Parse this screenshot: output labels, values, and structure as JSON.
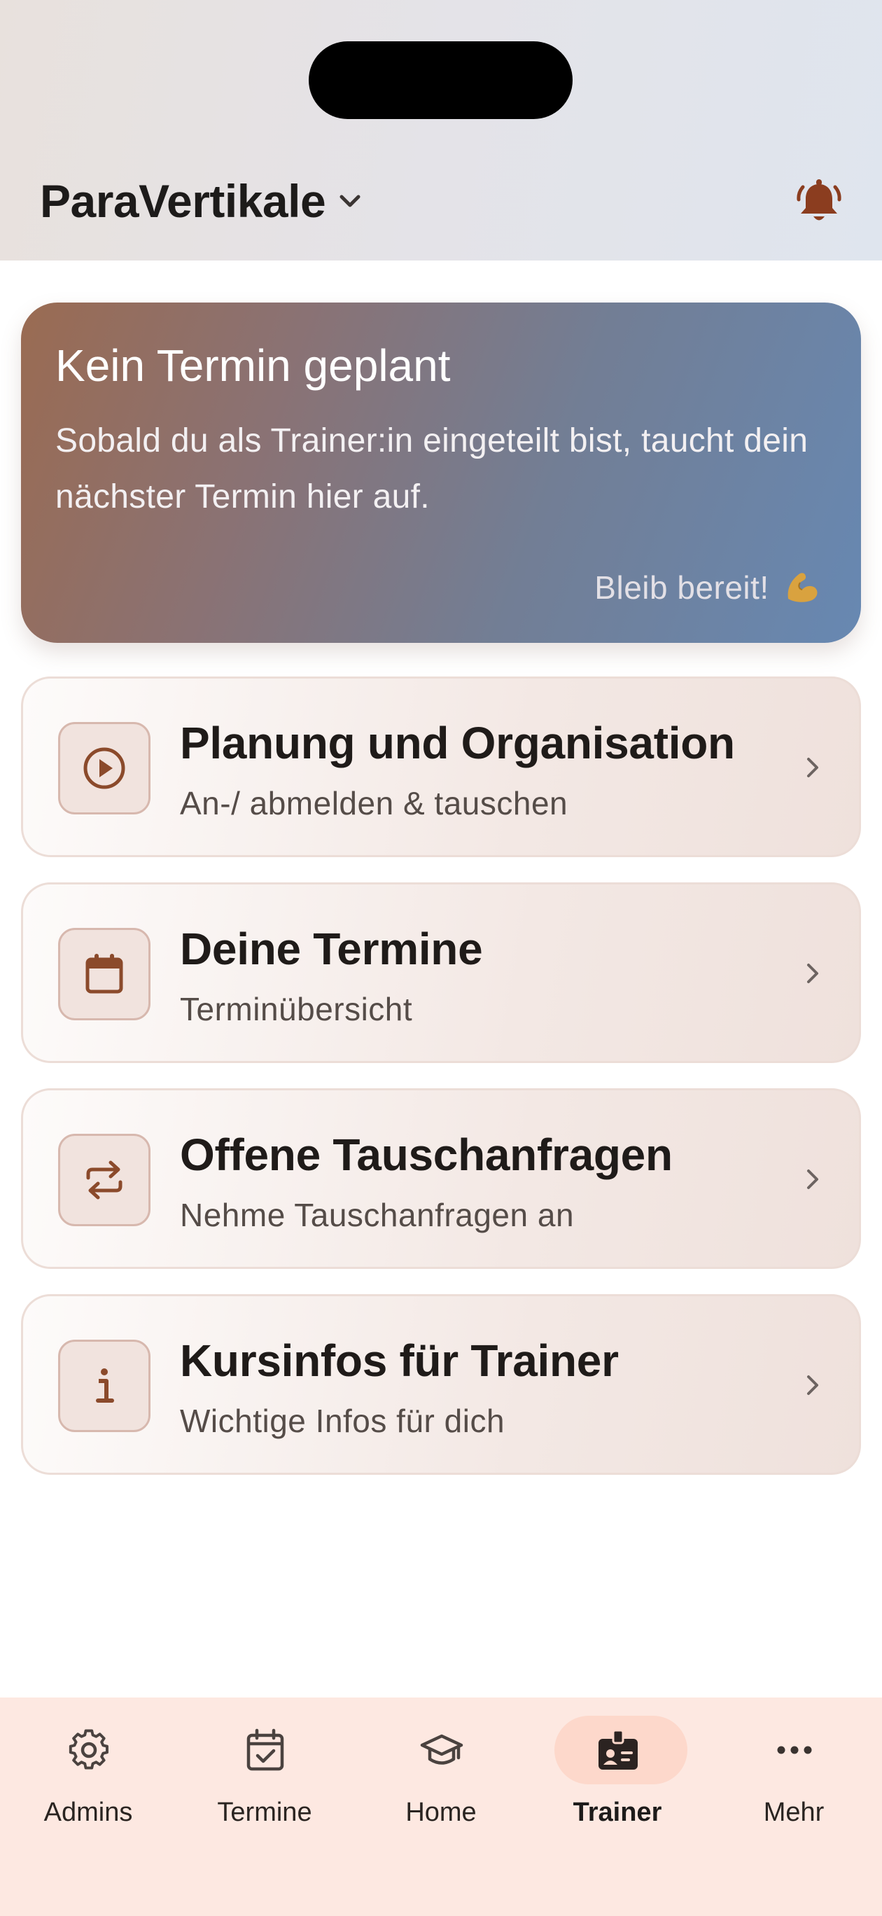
{
  "header": {
    "title": "ParaVertikale",
    "title_icon": "chevron-down-icon",
    "bell_icon": "bell-icon"
  },
  "hero": {
    "title": "Kein Termin geplant",
    "text": "Sobald du als Trainer:in eingeteilt bist, taucht dein nächster Termin hier auf.",
    "footer": "Bleib bereit!",
    "footer_emoji": "flexed-biceps-emoji"
  },
  "cards": [
    {
      "icon": "play-circle-icon",
      "title": "Planung und Organisation",
      "subtitle": "An-/ abmelden & tauschen"
    },
    {
      "icon": "calendar-icon",
      "title": "Deine Termine",
      "subtitle": "Terminübersicht"
    },
    {
      "icon": "swap-icon",
      "title": "Offene Tauschanfragen",
      "subtitle": "Nehme Tauschanfragen an"
    },
    {
      "icon": "info-icon",
      "title": "Kursinfos für Trainer",
      "subtitle": "Wichtige Infos für dich"
    }
  ],
  "nav": {
    "items": [
      {
        "label": "Admins",
        "icon": "gear-icon",
        "active": false
      },
      {
        "label": "Termine",
        "icon": "calendar-check-icon",
        "active": false
      },
      {
        "label": "Home",
        "icon": "graduation-cap-icon",
        "active": false
      },
      {
        "label": "Trainer",
        "icon": "id-badge-icon",
        "active": true
      },
      {
        "label": "Mehr",
        "icon": "more-dots-icon",
        "active": false
      }
    ]
  },
  "colors": {
    "accent": "#8b4a2b",
    "nav_background": "#fde8e1",
    "nav_active_pill": "#fdd8cb",
    "hero_gradient_start": "#9a6b52",
    "hero_gradient_end": "#6788b2"
  }
}
